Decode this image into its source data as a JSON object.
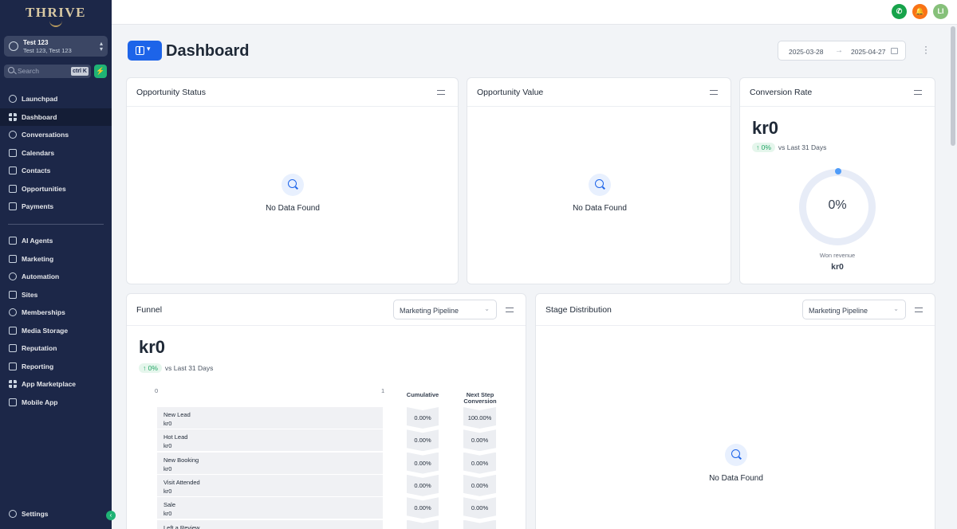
{
  "sidebar": {
    "logo_text": "THRIVE",
    "account": {
      "name": "Test 123",
      "sub": "Test 123, Test 123"
    },
    "search": {
      "placeholder": "Search",
      "shortcut": "ctrl K"
    },
    "quick_action_icon": "lightning-icon",
    "items": [
      {
        "label": "Launchpad",
        "icon": "rocket-icon",
        "active": false
      },
      {
        "label": "Dashboard",
        "icon": "grid-icon",
        "active": true
      },
      {
        "label": "Conversations",
        "icon": "chat-icon",
        "active": false
      },
      {
        "label": "Calendars",
        "icon": "calendar-icon",
        "active": false
      },
      {
        "label": "Contacts",
        "icon": "contacts-icon",
        "active": false
      },
      {
        "label": "Opportunities",
        "icon": "opportunities-icon",
        "active": false
      },
      {
        "label": "Payments",
        "icon": "payments-icon",
        "active": false
      },
      {
        "label": "AI Agents",
        "icon": "sparkle-icon",
        "active": false
      },
      {
        "label": "Marketing",
        "icon": "send-icon",
        "active": false
      },
      {
        "label": "Automation",
        "icon": "automation-icon",
        "active": false
      },
      {
        "label": "Sites",
        "icon": "sites-icon",
        "active": false
      },
      {
        "label": "Memberships",
        "icon": "badge-icon",
        "active": false
      },
      {
        "label": "Media Storage",
        "icon": "image-icon",
        "active": false
      },
      {
        "label": "Reputation",
        "icon": "star-icon",
        "active": false
      },
      {
        "label": "Reporting",
        "icon": "trend-icon",
        "active": false
      },
      {
        "label": "App Marketplace",
        "icon": "apps-icon",
        "active": false
      },
      {
        "label": "Mobile App",
        "icon": "mobile-icon",
        "active": false
      }
    ],
    "settings_label": "Settings"
  },
  "topbar": {
    "phone_color": "#16a34a",
    "bell_color": "#f97316",
    "avatar_initials": "LI",
    "avatar_color": "#86c07a"
  },
  "header": {
    "title": "Dashboard",
    "date_from": "2025-03-28",
    "date_to": "2025-04-27"
  },
  "opportunity_status": {
    "title": "Opportunity Status",
    "empty": "No Data Found"
  },
  "opportunity_value": {
    "title": "Opportunity Value",
    "empty": "No Data Found"
  },
  "conversion_rate": {
    "title": "Conversion Rate",
    "value": "kr0",
    "change": "↑ 0%",
    "compare": "vs Last 31 Days",
    "percent": "0%",
    "won_label": "Won revenue",
    "won_value": "kr0"
  },
  "funnel": {
    "title": "Funnel",
    "pipeline": "Marketing Pipeline",
    "value": "kr0",
    "change": "↑ 0%",
    "compare": "vs Last 31 Days",
    "axis_min": "0",
    "axis_max": "1",
    "col_cumulative": "Cumulative",
    "col_next_step_1": "Next Step",
    "col_next_step_2": "Conversion",
    "rows": [
      {
        "stage": "New Lead",
        "value": "kr0",
        "cumulative": "0.00%",
        "next": "100.00%"
      },
      {
        "stage": "Hot Lead",
        "value": "kr0",
        "cumulative": "0.00%",
        "next": "0.00%"
      },
      {
        "stage": "New Booking",
        "value": "kr0",
        "cumulative": "0.00%",
        "next": "0.00%"
      },
      {
        "stage": "Visit Attended",
        "value": "kr0",
        "cumulative": "0.00%",
        "next": "0.00%"
      },
      {
        "stage": "Sale",
        "value": "kr0",
        "cumulative": "0.00%",
        "next": "0.00%"
      },
      {
        "stage": "Left a Review",
        "value": "",
        "cumulative": "",
        "next": ""
      }
    ]
  },
  "stage_distribution": {
    "title": "Stage Distribution",
    "pipeline": "Marketing Pipeline",
    "empty": "No Data Found"
  }
}
